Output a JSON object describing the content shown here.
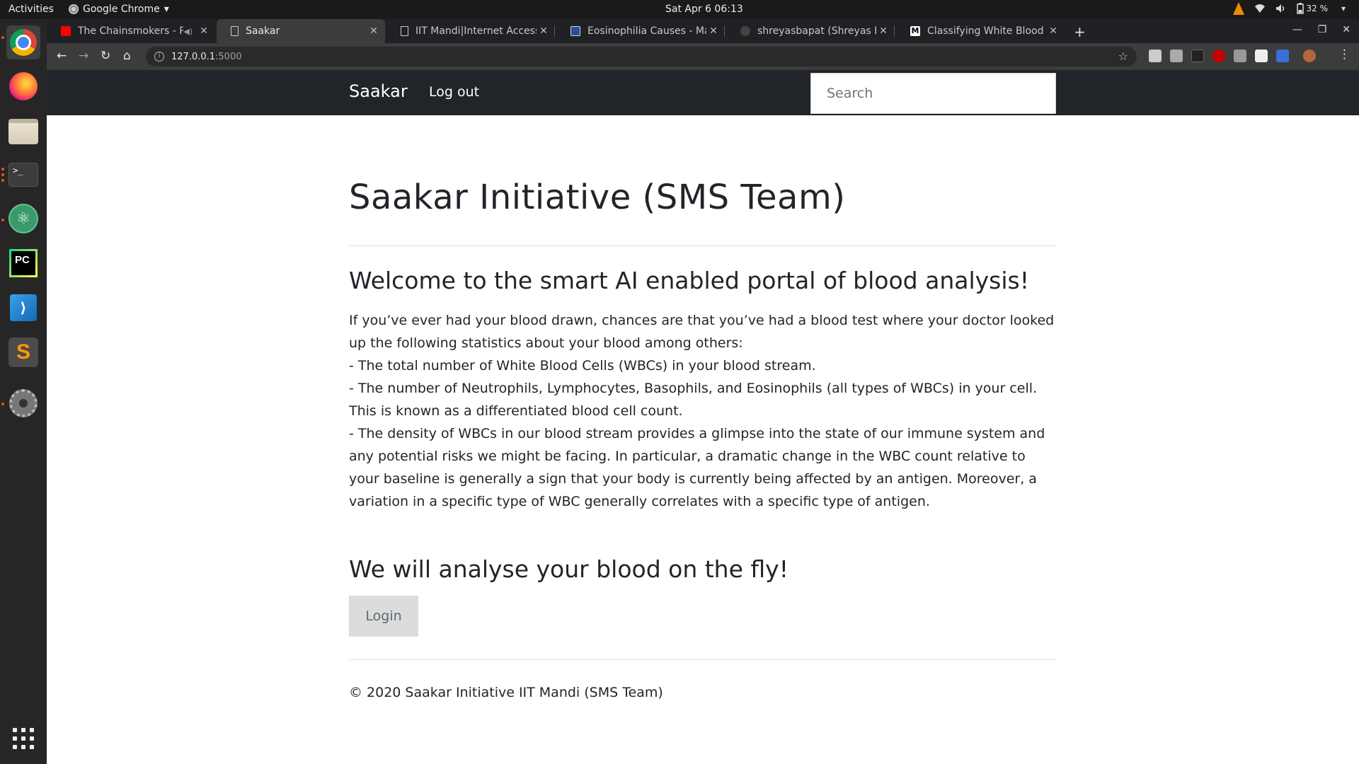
{
  "os": {
    "activities": "Activities",
    "app_name": "Google Chrome",
    "app_arrow": "▾",
    "clock": "Sat Apr 6  06:13",
    "battery": "32 %",
    "dock": [
      "Chrome",
      "Firefox",
      "Files",
      "Terminal",
      "Atom",
      "PyCharm",
      "VS Code",
      "Sublime Text",
      "Settings"
    ]
  },
  "browser": {
    "tabs": [
      {
        "title": "The Chainsmokers - Pa",
        "favicon": "youtube-icon"
      },
      {
        "title": "Saakar",
        "favicon": "page-icon"
      },
      {
        "title": "IIT Mandi|Internet Access",
        "favicon": "page-icon"
      },
      {
        "title": "Eosinophilia Causes - May",
        "favicon": "mayo-icon"
      },
      {
        "title": "shreyasbapat (Shreyas Ba",
        "favicon": "github-icon"
      },
      {
        "title": "Classifying White Blood C",
        "favicon": "medium-icon"
      }
    ],
    "url_host": "127.0.0.1",
    "url_port": ":5000",
    "new_tab": "+",
    "close_glyph": "✕"
  },
  "site": {
    "brand": "Saakar",
    "logout": "Log out",
    "search_placeholder": "Search",
    "title": "Saakar Initiative (SMS Team)",
    "welcome": "Welcome to the smart AI enabled portal of blood analysis!",
    "intro": [
      "If you’ve ever had your blood drawn, chances are that you’ve had a blood test where your doctor looked up the following statistics about your blood among others:",
      "- The total number of White Blood Cells (WBCs) in your blood stream.",
      "- The number of Neutrophils, Lymphocytes, Basophils, and Eosinophils (all types of WBCs) in your cell. This is known as a differentiated blood cell count.",
      "- The density of WBCs in our blood stream provides a glimpse into the state of our immune system and any potential risks we might be facing. In particular, a dramatic change in the WBC count relative to your baseline is generally a sign that your body is currently being affected by an antigen. Moreover, a variation in a specific type of WBC generally correlates with a specific type of antigen."
    ],
    "analyse": "We will analyse your blood on the fly!",
    "login": "Login",
    "footer": "© 2020 Saakar Initiative IIT Mandi (SMS Team)"
  },
  "colors": {
    "navbar": "#212529",
    "login_bg": "#dcdcdc",
    "ubuntu_accent": "#e95420"
  }
}
